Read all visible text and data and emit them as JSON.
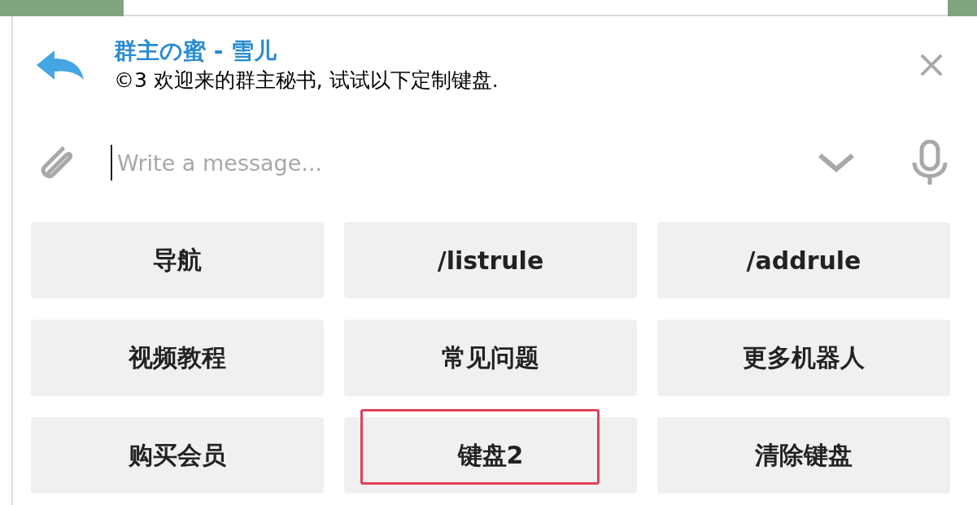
{
  "reply_bar": {
    "title": "群主の蜜 - 雪儿",
    "message": "©3 欢迎来的群主秘书, 试试以下定制键盘."
  },
  "composer": {
    "placeholder": "Write a message..."
  },
  "keyboard": [
    [
      {
        "label": "导航",
        "highlighted": false
      },
      {
        "label": "/listrule",
        "highlighted": false
      },
      {
        "label": "/addrule",
        "highlighted": false
      }
    ],
    [
      {
        "label": "视频教程",
        "highlighted": false
      },
      {
        "label": "常见问题",
        "highlighted": false
      },
      {
        "label": "更多机器人",
        "highlighted": false
      }
    ],
    [
      {
        "label": "购买会员",
        "highlighted": false
      },
      {
        "label": "键盘2",
        "highlighted": true
      },
      {
        "label": "清除键盘",
        "highlighted": false
      }
    ]
  ]
}
